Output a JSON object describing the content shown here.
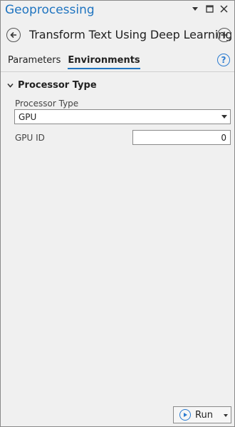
{
  "pane": {
    "title": "Geoprocessing"
  },
  "tool": {
    "title": "Transform Text Using Deep Learning"
  },
  "tabs": [
    {
      "label": "Parameters",
      "active": false
    },
    {
      "label": "Environments",
      "active": true
    }
  ],
  "section": {
    "title": "Processor Type",
    "expanded": true
  },
  "fields": {
    "processor_type": {
      "label": "Processor Type",
      "value": "GPU"
    },
    "gpu_id": {
      "label": "GPU ID",
      "value": "0"
    }
  },
  "run_button": {
    "label": "Run"
  },
  "colors": {
    "accent": "#1f74c0",
    "background": "#f0f0f0"
  },
  "icons": {
    "back": "back-arrow-icon",
    "add": "add-plus-icon",
    "help": "help-icon",
    "run": "play-icon"
  }
}
